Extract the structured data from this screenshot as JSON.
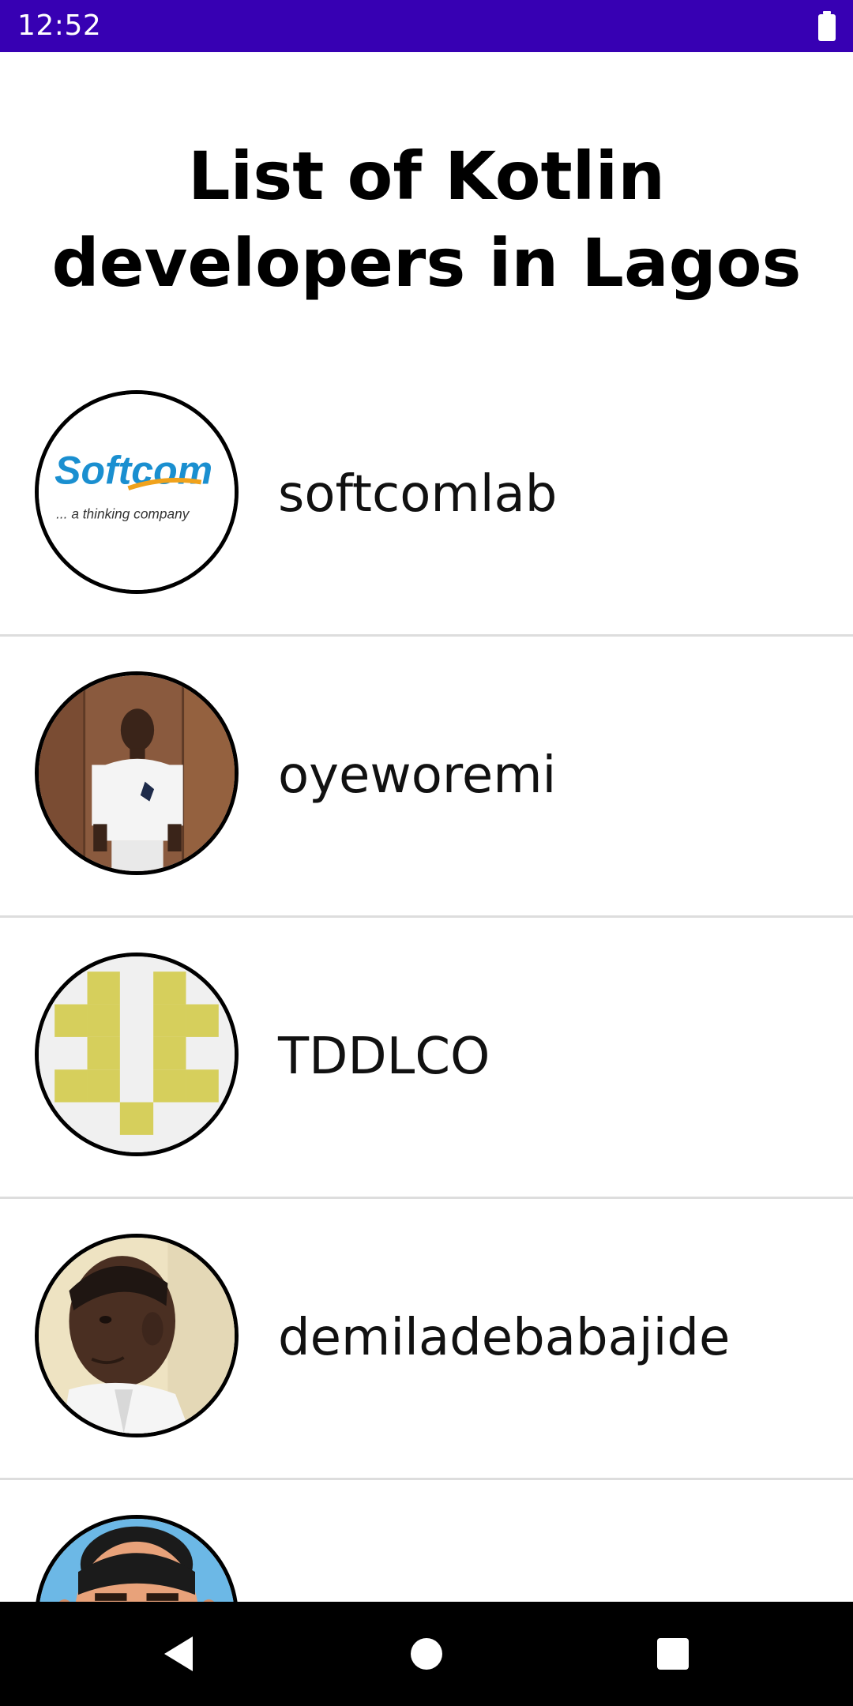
{
  "status_bar": {
    "time": "12:52",
    "background": "#3700B3",
    "battery_icon": "battery-full-icon"
  },
  "page": {
    "title": "List of Kotlin\ndevelopers in Lagos"
  },
  "developers": [
    {
      "username": "softcomlab",
      "avatar": "softcom-logo",
      "logo_text": "Softcom",
      "logo_tagline": "... a thinking company"
    },
    {
      "username": "oyeworemi",
      "avatar": "person-photo"
    },
    {
      "username": "TDDLCO",
      "avatar": "identicon"
    },
    {
      "username": "demiladebabajide",
      "avatar": "person-photo"
    },
    {
      "username": "",
      "avatar": "cartoon-avatar"
    }
  ],
  "nav_bar": {
    "back_icon": "back-triangle-icon",
    "home_icon": "home-circle-icon",
    "recents_icon": "recents-square-icon"
  },
  "colors": {
    "status_bar": "#3700B3",
    "divider": "#dddddd",
    "softcom_blue": "#1a8fd0",
    "softcom_orange": "#f0a21c",
    "identicon_yellow": "#d6cf5c",
    "identicon_bg": "#f0f0f0"
  }
}
